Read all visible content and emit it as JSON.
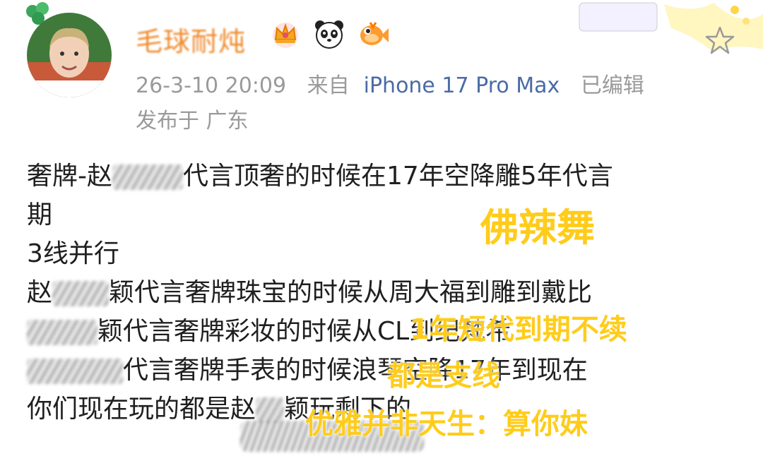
{
  "post": {
    "username": "毛球耐炖",
    "badges": [
      "crown-badge-icon",
      "panda-badge-icon",
      "fish-badge-icon"
    ],
    "meta": {
      "date": "26-3-10 20:09",
      "source_prefix": "来自",
      "device": "iPhone 17 Pro Max",
      "edited": "已编辑",
      "location": "发布于 广东"
    },
    "content_lines": [
      {
        "before": "奢牌-赵",
        "after": "代言顶奢的时候在17年空降雕5年代言"
      },
      {
        "before": "期",
        "after": ""
      },
      {
        "before": "3线并行",
        "after": ""
      },
      {
        "before": "赵",
        "after": "颖代言奢牌珠宝的时候从周大福到雕到戴比"
      },
      {
        "before": "",
        "after": "颖代言奢牌彩妆的时候从CL到纪梵希"
      },
      {
        "before": "",
        "after": "代言奢牌手表的时候浪琴空降17年到现在"
      },
      {
        "before": "你们现在玩的都是赵",
        "after": "颖玩剩下的"
      }
    ]
  },
  "overlays": [
    {
      "text": "佛辣舞"
    },
    {
      "text": "1年短代到期不续"
    },
    {
      "text": "都是支线"
    },
    {
      "text": "优雅并非天生：算你妹"
    }
  ],
  "colors": {
    "username": "#f08a2c",
    "meta": "#9a9a9a",
    "device_link": "#4a6ba6",
    "overlay_text": "#ffcc1a"
  }
}
